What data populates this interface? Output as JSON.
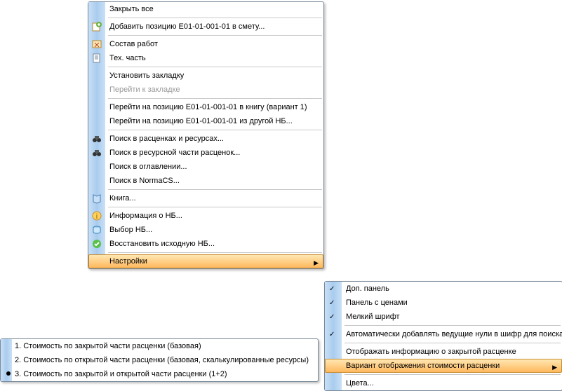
{
  "main": {
    "close_all": "Закрыть все",
    "add_position": "Добавить позицию E01-01-001-01 в смету...",
    "composition": "Состав работ",
    "tech_part": "Тех. часть",
    "set_bookmark": "Установить закладку",
    "go_bookmark": "Перейти к закладке",
    "go_position_book": "Перейти на позицию E01-01-001-01 в книгу (вариант 1)",
    "go_position_db": "Перейти на позицию E01-01-001-01 из другой НБ...",
    "search_resources": "Поиск в расценках и ресурсах...",
    "search_resource_part": "Поиск в ресурсной части расценок...",
    "search_toc": "Поиск в оглавлении...",
    "search_normacs": "Поиск в NormaCS...",
    "book": "Книга...",
    "info_db": "Информация о НБ...",
    "choose_db": "Выбор НБ...",
    "restore_db": "Восстановить исходную НБ...",
    "settings": "Настройки"
  },
  "sub": {
    "extra_panel": "Доп. панель",
    "price_panel": "Панель с ценами",
    "small_font": "Мелкий шрифт",
    "auto_zeros": "Автоматически добавлять ведущие нули в шифр для поиска",
    "show_closed": "Отображать информацию о закрытой расценке",
    "cost_variant": "Вариант отображения стоимости расценки",
    "colors": "Цвета..."
  },
  "third": {
    "v1": "1. Стоимость по закрытой части расценки (базовая)",
    "v2": "2. Стоимость по открытой части расценки (базовая, скалькулированные ресурсы)",
    "v3": "3. Стоимость по закрытой и открытой части расценки (1+2)"
  }
}
